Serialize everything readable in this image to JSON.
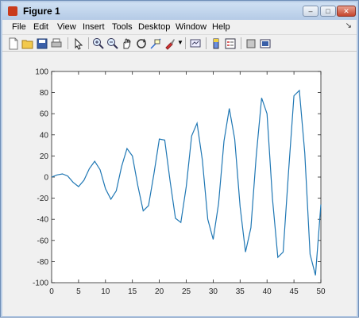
{
  "window": {
    "title": "Figure 1"
  },
  "menubar": {
    "items": [
      "File",
      "Edit",
      "View",
      "Insert",
      "Tools",
      "Desktop",
      "Window",
      "Help"
    ]
  },
  "toolbar": {
    "icons": [
      "new-figure-icon",
      "open-icon",
      "save-icon",
      "print-icon",
      "pointer-icon",
      "zoom-in-icon",
      "zoom-out-icon",
      "pan-icon",
      "rotate-icon",
      "data-cursor-icon",
      "brush-icon",
      "link-icon",
      "colorbar-icon",
      "legend-icon",
      "hide-plot-tools-icon",
      "show-plot-tools-icon"
    ]
  },
  "chart_data": {
    "type": "line",
    "title": "",
    "xlabel": "",
    "ylabel": "",
    "xlim": [
      0,
      50
    ],
    "ylim": [
      -100,
      100
    ],
    "xticks": [
      0,
      5,
      10,
      15,
      20,
      25,
      30,
      35,
      40,
      45,
      50
    ],
    "yticks": [
      -100,
      -80,
      -60,
      -40,
      -20,
      0,
      20,
      40,
      60,
      80,
      100
    ],
    "grid": false,
    "series": [
      {
        "color": "#1f77b4",
        "x": [
          0,
          1,
          2,
          3,
          4,
          5,
          6,
          7,
          8,
          9,
          10,
          11,
          12,
          13,
          14,
          15,
          16,
          17,
          18,
          19,
          20,
          21,
          22,
          23,
          24,
          25,
          26,
          27,
          28,
          29,
          30,
          31,
          32,
          33,
          34,
          35,
          36,
          37,
          38,
          39,
          40,
          41,
          42,
          43,
          44,
          45,
          46,
          47,
          48,
          49,
          50
        ],
        "y": [
          0,
          2,
          3,
          1,
          -5,
          -9,
          -3,
          8,
          15,
          7,
          -11,
          -21,
          -13,
          10,
          27,
          20,
          -8,
          -32,
          -27,
          3,
          36,
          35,
          -4,
          -39,
          -43,
          -9,
          39,
          51,
          16,
          -40,
          -59,
          -25,
          34,
          65,
          36,
          -28,
          -71,
          -48,
          20,
          75,
          60,
          -20,
          -76,
          -71,
          5,
          77,
          82,
          23,
          -73,
          -93,
          -26
        ]
      }
    ]
  }
}
